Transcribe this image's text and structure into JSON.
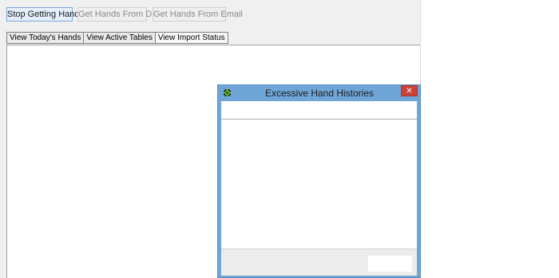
{
  "toolbar": {
    "stop_label": "Stop Getting Hands",
    "disk_label": "Get Hands From Disk",
    "email_label": "Get Hands From Email"
  },
  "tabs": [
    {
      "label": "View Today's Hands"
    },
    {
      "label": "View Active Tables"
    },
    {
      "label": "View Import Status"
    }
  ],
  "dialog": {
    "title": "Excessive Hand Histories",
    "close_glyph": "✕"
  },
  "colors": {
    "dialog_frame": "#6fa6d7",
    "close_button": "#c9433b",
    "active_button": "#e4effb"
  },
  "icons": {
    "dialog_icon": "poker-chip-icon"
  }
}
